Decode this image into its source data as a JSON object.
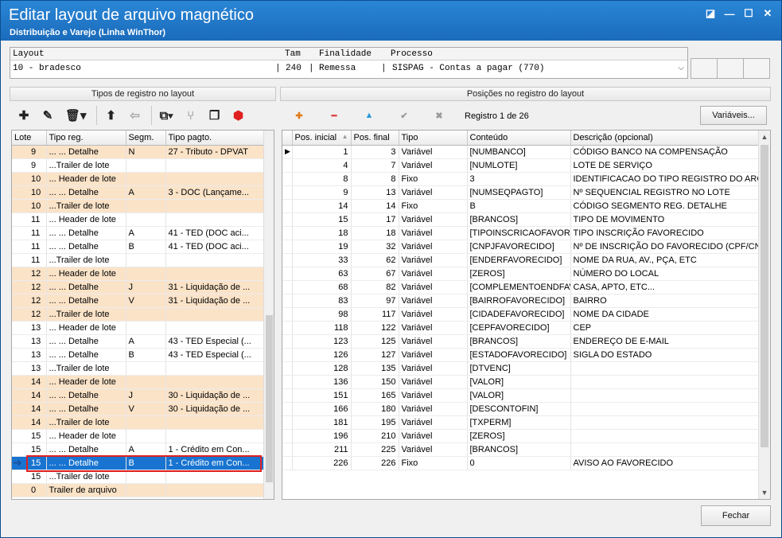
{
  "window": {
    "title": "Editar layout de arquivo magnético",
    "subtitle": "Distribuição e Varejo (Linha WinThor)",
    "buttons": {
      "restore": "◪",
      "minimize": "—",
      "maximize": "☐",
      "close": "✕"
    }
  },
  "layout": {
    "headers": {
      "layout": "Layout",
      "tam": "Tam",
      "finalidade": "Finalidade",
      "processo": "Processo"
    },
    "values": {
      "layout": "10 - bradesco",
      "sep1": "|",
      "tam": "240",
      "sep2": "|",
      "finalidade": "Remessa",
      "sep3": "|",
      "processo": "SISPAG - Contas a pagar (770)"
    }
  },
  "left_panel": {
    "title": "Tipos de registro no layout",
    "toolbar": [
      {
        "name": "add-icon",
        "glyph": "✚"
      },
      {
        "name": "edit-icon",
        "glyph": "✎"
      },
      {
        "name": "delete-icon",
        "glyph": "🗑▾"
      },
      {
        "name": "move-up-icon",
        "glyph": "⬆"
      },
      {
        "name": "undo-icon",
        "glyph": "⇦"
      },
      {
        "name": "copy-menu-icon",
        "glyph": "⧉▾"
      },
      {
        "name": "hierarchy-icon",
        "glyph": "⑂"
      },
      {
        "name": "duplicate-icon",
        "glyph": "❐"
      },
      {
        "name": "validate-icon",
        "glyph": "⬢"
      }
    ],
    "columns": [
      "Lote",
      "Tipo reg.",
      "Segm.",
      "Tipo pagto."
    ],
    "rows": [
      {
        "lote": "9",
        "tipo": "... ... Detalhe",
        "segm": "N",
        "pagto": "27 - Tributo - DPVAT",
        "style": "orange"
      },
      {
        "lote": "9",
        "tipo": "...Trailer de lote",
        "segm": "",
        "pagto": "",
        "style": "white"
      },
      {
        "lote": "10",
        "tipo": "... Header de lote",
        "segm": "",
        "pagto": "",
        "style": "orange"
      },
      {
        "lote": "10",
        "tipo": "... ... Detalhe",
        "segm": "A",
        "pagto": "3 - DOC (Lançame...",
        "style": "orange"
      },
      {
        "lote": "10",
        "tipo": "...Trailer de lote",
        "segm": "",
        "pagto": "",
        "style": "orange"
      },
      {
        "lote": "11",
        "tipo": "... Header de lote",
        "segm": "",
        "pagto": "",
        "style": "white"
      },
      {
        "lote": "11",
        "tipo": "... ... Detalhe",
        "segm": "A",
        "pagto": "41 - TED (DOC aci...",
        "style": "white"
      },
      {
        "lote": "11",
        "tipo": "... ... Detalhe",
        "segm": "B",
        "pagto": "41 - TED (DOC aci...",
        "style": "white"
      },
      {
        "lote": "11",
        "tipo": "...Trailer de lote",
        "segm": "",
        "pagto": "",
        "style": "white"
      },
      {
        "lote": "12",
        "tipo": "... Header de lote",
        "segm": "",
        "pagto": "",
        "style": "orange"
      },
      {
        "lote": "12",
        "tipo": "... ... Detalhe",
        "segm": "J",
        "pagto": "31 - Liquidação de ...",
        "style": "orange"
      },
      {
        "lote": "12",
        "tipo": "... ... Detalhe",
        "segm": "V",
        "pagto": "31 - Liquidação de ...",
        "style": "orange"
      },
      {
        "lote": "12",
        "tipo": "...Trailer de lote",
        "segm": "",
        "pagto": "",
        "style": "orange"
      },
      {
        "lote": "13",
        "tipo": "... Header de lote",
        "segm": "",
        "pagto": "",
        "style": "white"
      },
      {
        "lote": "13",
        "tipo": "... ... Detalhe",
        "segm": "A",
        "pagto": "43 - TED Especial (...",
        "style": "white"
      },
      {
        "lote": "13",
        "tipo": "... ... Detalhe",
        "segm": "B",
        "pagto": "43 - TED Especial (...",
        "style": "white"
      },
      {
        "lote": "13",
        "tipo": "...Trailer de lote",
        "segm": "",
        "pagto": "",
        "style": "white"
      },
      {
        "lote": "14",
        "tipo": "... Header de lote",
        "segm": "",
        "pagto": "",
        "style": "orange"
      },
      {
        "lote": "14",
        "tipo": "... ... Detalhe",
        "segm": "J",
        "pagto": "30 - Liquidação de ...",
        "style": "orange"
      },
      {
        "lote": "14",
        "tipo": "... ... Detalhe",
        "segm": "V",
        "pagto": "30 - Liquidação de ...",
        "style": "orange"
      },
      {
        "lote": "14",
        "tipo": "...Trailer de lote",
        "segm": "",
        "pagto": "",
        "style": "orange"
      },
      {
        "lote": "15",
        "tipo": "... Header de lote",
        "segm": "",
        "pagto": "",
        "style": "white"
      },
      {
        "lote": "15",
        "tipo": "... ... Detalhe",
        "segm": "A",
        "pagto": "1 - Crédito em Con...",
        "style": "white"
      },
      {
        "lote": "15",
        "tipo": "... ... Detalhe",
        "segm": "B",
        "pagto": "1 - Crédito em Con...",
        "style": "sel"
      },
      {
        "lote": "15",
        "tipo": "...Trailer de lote",
        "segm": "",
        "pagto": "",
        "style": "white"
      },
      {
        "lote": "0",
        "tipo": "Trailer de arquivo",
        "segm": "",
        "pagto": "",
        "style": "orange"
      }
    ]
  },
  "right_panel": {
    "title": "Posições no registro do layout",
    "toolbar": [
      {
        "name": "add-position-icon",
        "glyph": "✚",
        "color": "#e07a1a"
      },
      {
        "name": "remove-position-icon",
        "glyph": "━",
        "color": "#e04040"
      },
      {
        "name": "move-up-position-icon",
        "glyph": "▲",
        "color": "#2a9ad6"
      },
      {
        "name": "confirm-icon",
        "glyph": "✔",
        "color": "#9a9a9a"
      },
      {
        "name": "cancel-icon",
        "glyph": "✖",
        "color": "#9a9a9a"
      }
    ],
    "record_status": "Registro 1 de 26",
    "variables_button": "Variáveis...",
    "columns": [
      "Pos. inicial",
      "Pos. final",
      "Tipo",
      "Conteúdo",
      "Descrição (opcional)"
    ],
    "rows": [
      {
        "ini": "1",
        "fim": "3",
        "tipo": "Variável",
        "cont": "[NUMBANCO]",
        "desc": "CÓDIGO BANCO NA COMPENSAÇÃO"
      },
      {
        "ini": "4",
        "fim": "7",
        "tipo": "Variável",
        "cont": "[NUMLOTE]",
        "desc": "LOTE DE SERVIÇO"
      },
      {
        "ini": "8",
        "fim": "8",
        "tipo": "Fixo",
        "cont": "3",
        "desc": "IDENTIFICACAO DO TIPO REGISTRO DO ARC"
      },
      {
        "ini": "9",
        "fim": "13",
        "tipo": "Variável",
        "cont": "[NUMSEQPAGTO]",
        "desc": "Nº SEQUENCIAL REGISTRO NO LOTE"
      },
      {
        "ini": "14",
        "fim": "14",
        "tipo": "Fixo",
        "cont": "B",
        "desc": "CÓDIGO SEGMENTO REG. DETALHE"
      },
      {
        "ini": "15",
        "fim": "17",
        "tipo": "Variável",
        "cont": "[BRANCOS]",
        "desc": "TIPO DE MOVIMENTO"
      },
      {
        "ini": "18",
        "fim": "18",
        "tipo": "Variável",
        "cont": "[TIPOINSCRICAOFAVORE",
        "desc": "TIPO INSCRIÇÃO FAVORECIDO"
      },
      {
        "ini": "19",
        "fim": "32",
        "tipo": "Variável",
        "cont": "[CNPJFAVORECIDO]",
        "desc": "Nº DE INSCRIÇÃO DO FAVORECIDO (CPF/CN"
      },
      {
        "ini": "33",
        "fim": "62",
        "tipo": "Variável",
        "cont": "[ENDERFAVORECIDO]",
        "desc": "NOME DA RUA, AV., PÇA, ETC"
      },
      {
        "ini": "63",
        "fim": "67",
        "tipo": "Variável",
        "cont": "[ZEROS]",
        "desc": "NÚMERO DO LOCAL"
      },
      {
        "ini": "68",
        "fim": "82",
        "tipo": "Variável",
        "cont": "[COMPLEMENTOENDFAVO",
        "desc": "CASA, APTO, ETC..."
      },
      {
        "ini": "83",
        "fim": "97",
        "tipo": "Variável",
        "cont": "[BAIRROFAVORECIDO]",
        "desc": "BAIRRO"
      },
      {
        "ini": "98",
        "fim": "117",
        "tipo": "Variável",
        "cont": "[CIDADEFAVORECIDO]",
        "desc": "NOME DA CIDADE"
      },
      {
        "ini": "118",
        "fim": "122",
        "tipo": "Variável",
        "cont": "[CEPFAVORECIDO]",
        "desc": "CEP"
      },
      {
        "ini": "123",
        "fim": "125",
        "tipo": "Variável",
        "cont": "[BRANCOS]",
        "desc": "ENDEREÇO DE E-MAIL"
      },
      {
        "ini": "126",
        "fim": "127",
        "tipo": "Variável",
        "cont": "[ESTADOFAVORECIDO]",
        "desc": "SIGLA DO ESTADO"
      },
      {
        "ini": "128",
        "fim": "135",
        "tipo": "Variável",
        "cont": "[DTVENC]",
        "desc": ""
      },
      {
        "ini": "136",
        "fim": "150",
        "tipo": "Variável",
        "cont": "[VALOR]",
        "desc": ""
      },
      {
        "ini": "151",
        "fim": "165",
        "tipo": "Variável",
        "cont": "[VALOR]",
        "desc": ""
      },
      {
        "ini": "166",
        "fim": "180",
        "tipo": "Variável",
        "cont": "[DESCONTOFIN]",
        "desc": ""
      },
      {
        "ini": "181",
        "fim": "195",
        "tipo": "Variável",
        "cont": "[TXPERM]",
        "desc": ""
      },
      {
        "ini": "196",
        "fim": "210",
        "tipo": "Variável",
        "cont": "[ZEROS]",
        "desc": ""
      },
      {
        "ini": "211",
        "fim": "225",
        "tipo": "Variável",
        "cont": "[BRANCOS]",
        "desc": ""
      },
      {
        "ini": "226",
        "fim": "226",
        "tipo": "Fixo",
        "cont": "0",
        "desc": "AVISO AO FAVORECIDO"
      }
    ]
  },
  "footer": {
    "close_button": "Fechar"
  },
  "colors": {
    "title_bar": "#1b6bbb",
    "row_highlight": "#fbe3c8",
    "selection": "#1874d0",
    "selection_outline": "#e02020"
  }
}
